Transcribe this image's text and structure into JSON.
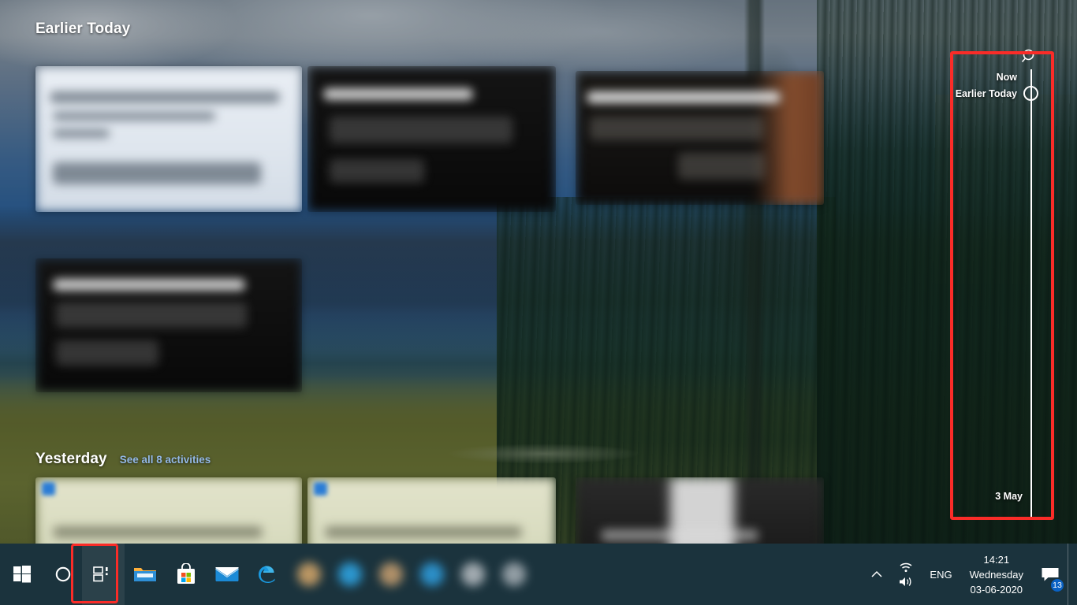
{
  "app": {
    "name": "Windows 10 Task View / Timeline",
    "wallpaper_alt": "mountain meadow with pine forest"
  },
  "timeline_groups": [
    {
      "title": "Earlier Today",
      "link": "",
      "thumbnails": [
        {
          "style": "card-light",
          "title_blurred": true
        },
        {
          "style": "card-dark",
          "title_blurred": true
        },
        {
          "style": "card-warm",
          "title_blurred": true
        },
        {
          "style": "card-dark",
          "title_blurred": true
        }
      ]
    },
    {
      "title": "Yesterday",
      "link": "See all 8 activities",
      "thumbnails": [
        {
          "style": "card-cream",
          "title_blurred": true
        },
        {
          "style": "card-cream",
          "title_blurred": true
        },
        {
          "style": "card-grey",
          "title_blurred": true
        }
      ]
    }
  ],
  "timeline_scrubber": {
    "search_icon": "search-icon",
    "now_label": "Now",
    "current_label": "Earlier Today",
    "bottom_date": "3 May"
  },
  "annotations": [
    {
      "name": "timeline-scrubber-highlight",
      "color": "#fa2c28"
    },
    {
      "name": "task-view-button-highlight",
      "color": "#fa2c28"
    }
  ],
  "taskbar": {
    "start_label": "Start",
    "cortana_label": "Cortana",
    "taskview_label": "Task View",
    "pinned": [
      {
        "name": "file-explorer",
        "label": "File Explorer"
      },
      {
        "name": "microsoft-store",
        "label": "Microsoft Store"
      },
      {
        "name": "mail",
        "label": "Mail"
      },
      {
        "name": "microsoft-edge",
        "label": "Microsoft Edge"
      }
    ],
    "running_blurred_count": 6,
    "tray": {
      "chevron_label": "Show hidden icons",
      "network_label": "Network",
      "volume_label": "Volume",
      "language": "ENG",
      "time": "14:21",
      "day": "Wednesday",
      "date": "03-06-2020",
      "action_center_badge": "13",
      "show_desktop_label": "Show desktop"
    }
  },
  "colors": {
    "taskbar_bg": "#1b333d",
    "annotation_red": "#fa2c28",
    "link_blue": "#93b8e6",
    "badge_blue": "#0a62c4",
    "text_white": "#ffffff"
  }
}
